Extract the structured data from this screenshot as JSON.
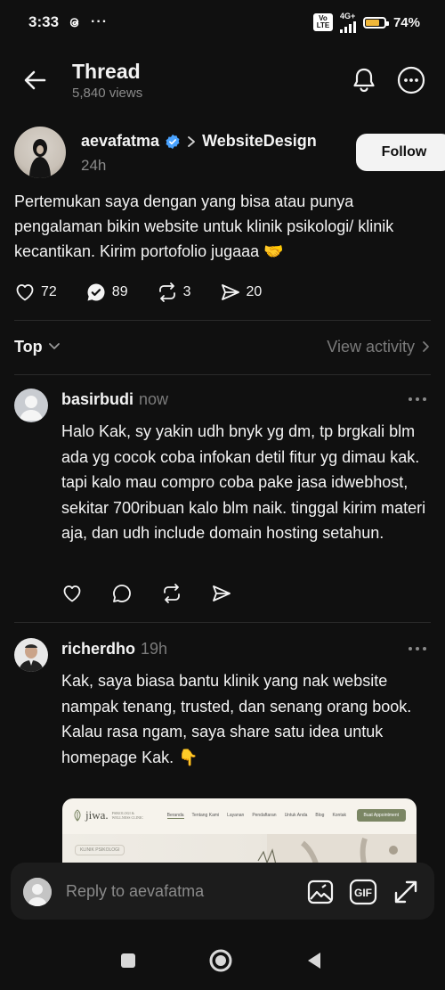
{
  "status": {
    "time": "3:33",
    "app_icon": "threads-icon",
    "more_dots": "···",
    "volte": "Vo LTE",
    "network": "4G+",
    "battery": "74%",
    "battery_level": 0.74,
    "battery_color": "#f1b83a"
  },
  "header": {
    "title": "Thread",
    "views": "5,840 views"
  },
  "post": {
    "author": "aevafatma",
    "topic": "WebsiteDesign",
    "time": "24h",
    "follow_label": "Follow",
    "text": "Pertemukan saya dengan yang bisa atau punya pengalaman bikin website untuk klinik psikologi/ klinik kecantikan. Kirim portofolio jugaaa 🤝",
    "likes": "72",
    "replies": "89",
    "reposts": "3",
    "shares": "20"
  },
  "sort": {
    "label": "Top",
    "view_activity": "View activity"
  },
  "replies": [
    {
      "username": "basirbudi",
      "time": "now",
      "text": "Halo Kak, sy yakin udh bnyk yg dm, tp brgkali blm ada yg cocok coba infokan detil fitur yg dimau kak. tapi kalo mau compro coba pake jasa idwebhost, sekitar 700ribuan kalo blm naik. tinggal kirim materi aja, dan udh include domain hosting setahun."
    },
    {
      "username": "richerdho",
      "time": "19h",
      "text": "Kak, saya biasa bantu klinik yang nak website nampak tenang, trusted, dan senang orang book.\nKalau rasa ngam, saya share satu idea untuk homepage Kak. 👇",
      "preview": {
        "logo": "jiwa.",
        "logo_tag": "PSIKOLOGI & WELLNESS CLINIC",
        "nav_links": [
          "Beranda",
          "Tentang Kami",
          "Layanan",
          "Pendaftaran",
          "Untuk Anda",
          "Blog",
          "Kontak"
        ],
        "cta": "Buat Appointment",
        "badge": "KLINIK PSIKOLOGI"
      }
    }
  ],
  "composer": {
    "placeholder": "Reply to aevafatma"
  },
  "colors": {
    "background": "#101010",
    "verified": "#4aa3ff",
    "muted": "#8a8a8a"
  }
}
